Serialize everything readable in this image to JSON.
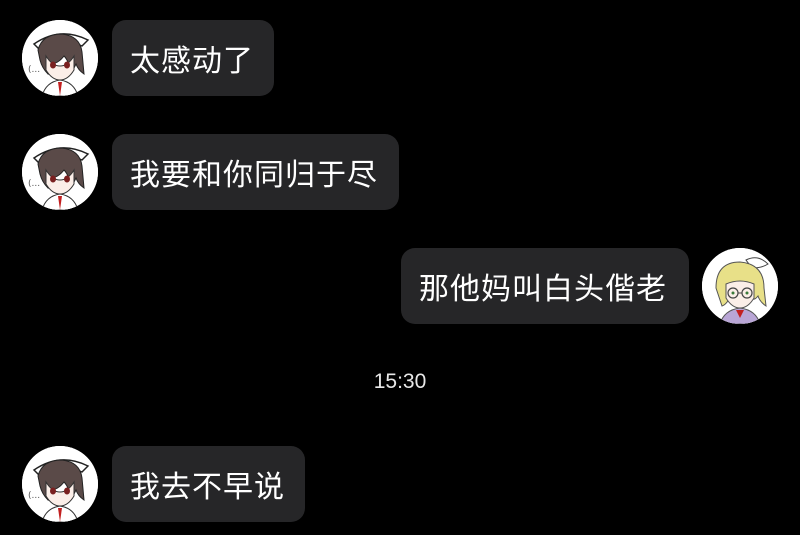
{
  "chat": {
    "messages": [
      {
        "sender": "other",
        "avatar_icon": "brown-hair-girl-avatar-icon",
        "text": "太感动了"
      },
      {
        "sender": "other",
        "avatar_icon": "brown-hair-girl-avatar-icon",
        "text": "我要和你同归于尽"
      },
      {
        "sender": "self",
        "avatar_icon": "blonde-glasses-girl-avatar-icon",
        "text": "那他妈叫白头偕老"
      },
      {
        "sender": "other",
        "avatar_icon": "brown-hair-girl-avatar-icon",
        "text": "我去不早说"
      }
    ],
    "timestamp": "15:30"
  },
  "colors": {
    "background": "#000000",
    "bubble": "#262628",
    "text": "#ffffff"
  }
}
